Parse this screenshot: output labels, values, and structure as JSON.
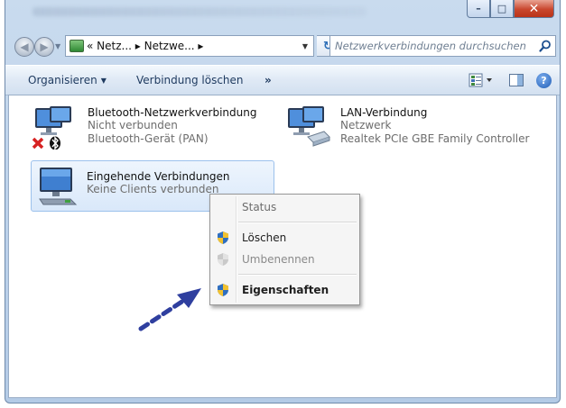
{
  "window": {
    "controls": {
      "minimize": "–",
      "maximize": "□",
      "close": "✕"
    }
  },
  "nav": {
    "back_glyph": "◀",
    "forward_glyph": "▶",
    "breadcrumb": "« Netz... ▸ Netzwe... ▸",
    "refresh_glyph": "↻",
    "search_placeholder": "Netzwerkverbindungen durchsuchen"
  },
  "toolbar": {
    "organize": "Organisieren",
    "delete_connection": "Verbindung löschen",
    "more": "»",
    "help": "?"
  },
  "connections": [
    {
      "name": "Bluetooth-Netzwerkverbindung",
      "status": "Nicht verbunden",
      "device": "Bluetooth-Gerät (PAN)",
      "icon": "bluetooth-network-icon"
    },
    {
      "name": "LAN-Verbindung",
      "status": "Netzwerk",
      "device": "Realtek PCIe GBE Family Controller",
      "icon": "lan-network-icon"
    },
    {
      "name": "Eingehende Verbindungen",
      "status": "Keine Clients verbunden",
      "icon": "incoming-connection-icon"
    }
  ],
  "context_menu": {
    "items": [
      {
        "label": "Status",
        "enabled": false
      },
      {
        "label": "Löschen",
        "enabled": true,
        "icon": "uac-shield-icon"
      },
      {
        "label": "Umbenennen",
        "enabled": false,
        "icon": "uac-shield-icon"
      },
      {
        "label": "Eigenschaften",
        "enabled": true,
        "bold": true,
        "icon": "uac-shield-icon"
      }
    ]
  },
  "colors": {
    "accent_arrow": "#2f3f9f",
    "selection_bg": "#d9e8fa",
    "close_button": "#c9472d"
  }
}
